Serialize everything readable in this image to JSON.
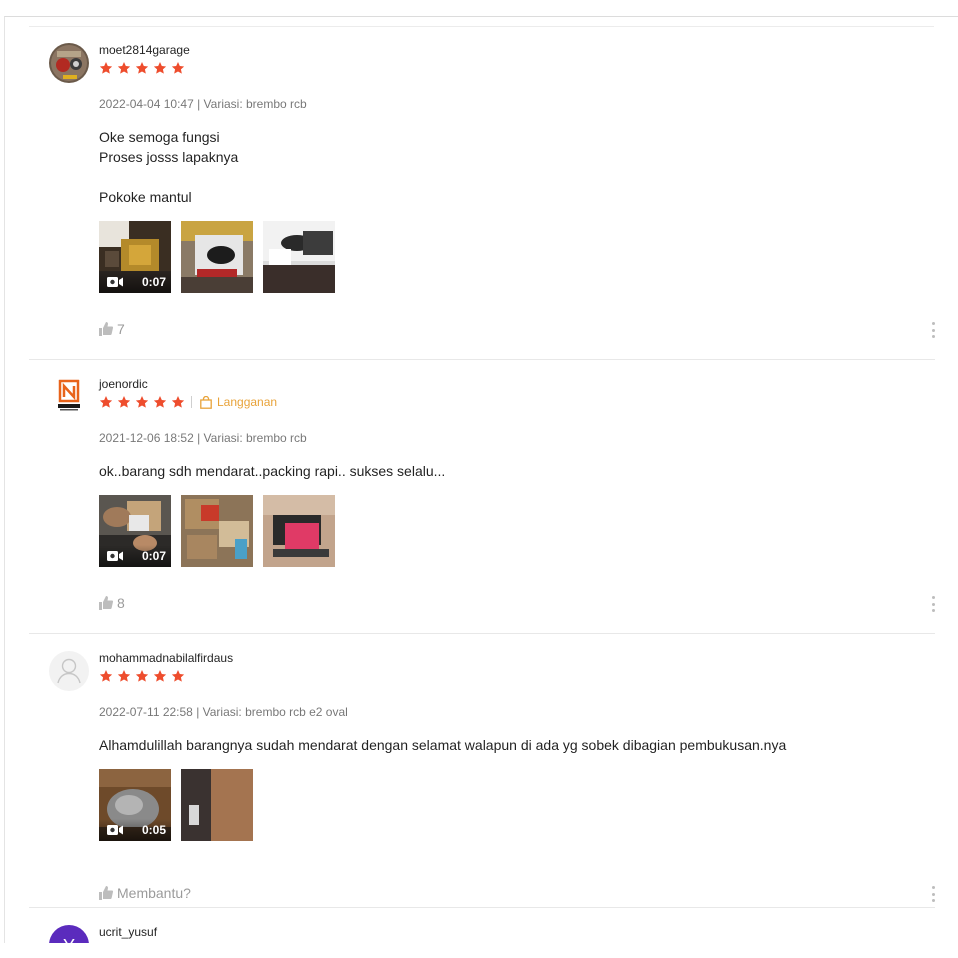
{
  "reviews": [
    {
      "username": "moet2814garage",
      "rating": 5,
      "avatar": "garage-photo",
      "meta": "2022-04-04 10:47 | Variasi: brembo rcb",
      "text": "Oke semoga fungsi\nProses josss lapaknya\n\nPokoke mantul",
      "media": [
        {
          "type": "video",
          "duration": "0:07"
        },
        {
          "type": "image"
        },
        {
          "type": "image"
        }
      ],
      "likes": "7"
    },
    {
      "username": "joenordic",
      "rating": 5,
      "avatar": "nordic-logo",
      "badge": "Langganan",
      "meta": "2021-12-06 18:52 | Variasi: brembo rcb",
      "text": "ok..barang sdh mendarat..packing rapi.. sukses selalu...",
      "media": [
        {
          "type": "video",
          "duration": "0:07"
        },
        {
          "type": "image"
        },
        {
          "type": "image"
        }
      ],
      "likes": "8"
    },
    {
      "username": "mohammadnabilalfirdaus",
      "rating": 5,
      "avatar": "default-user",
      "meta": "2022-07-11 22:58 | Variasi: brembo rcb e2 oval",
      "text": "Alhamdulillah barangnya sudah mendarat dengan selamat walapun di ada yg sobek dibagian pembukusan.nya",
      "media": [
        {
          "type": "video",
          "duration": "0:05"
        },
        {
          "type": "image"
        }
      ],
      "likes": "Membantu?"
    },
    {
      "username": "ucrit_yusuf",
      "avatar_letter": "Y"
    }
  ],
  "colors": {
    "star": "#ee4d2d",
    "badge": "#e8a33a",
    "avatar_purple": "#5b2bbd"
  }
}
